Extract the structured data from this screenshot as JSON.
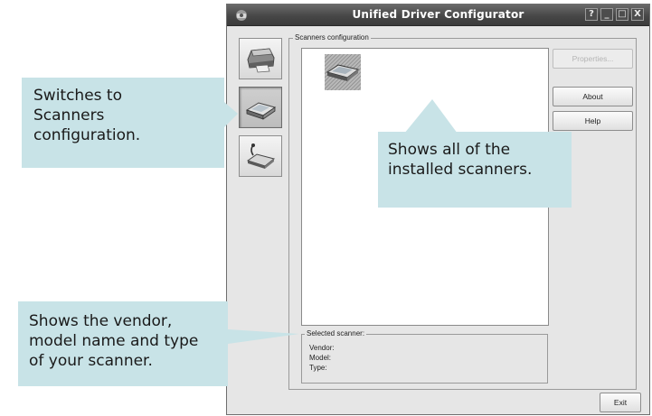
{
  "window": {
    "title": "Unified Driver Configurator",
    "controls": {
      "help": "?",
      "minimize": "_",
      "maximize": "□",
      "close": "X"
    }
  },
  "sidebar": {
    "buttons": [
      {
        "name": "printers",
        "icon": "printer-icon",
        "active": false
      },
      {
        "name": "scanners",
        "icon": "scanner-icon",
        "active": true
      },
      {
        "name": "ports",
        "icon": "port-icon",
        "active": false
      }
    ]
  },
  "scanners_group": {
    "label": "Scanners configuration",
    "selected": {
      "label": "Selected scanner:",
      "vendor_label": "Vendor:",
      "model_label": "Model:",
      "type_label": "Type:"
    }
  },
  "buttons": {
    "properties": "Properties...",
    "about": "About",
    "help": "Help",
    "exit": "Exit"
  },
  "callouts": {
    "switch": "Switches to\nScanners\nconfiguration.",
    "installed": "Shows all of the\ninstalled scanners.",
    "vendor": "Shows the vendor,\nmodel name and type\nof your scanner."
  },
  "colors": {
    "callout": "#c8e3e7",
    "titlebar": "#474747",
    "window": "#e6e6e6"
  }
}
